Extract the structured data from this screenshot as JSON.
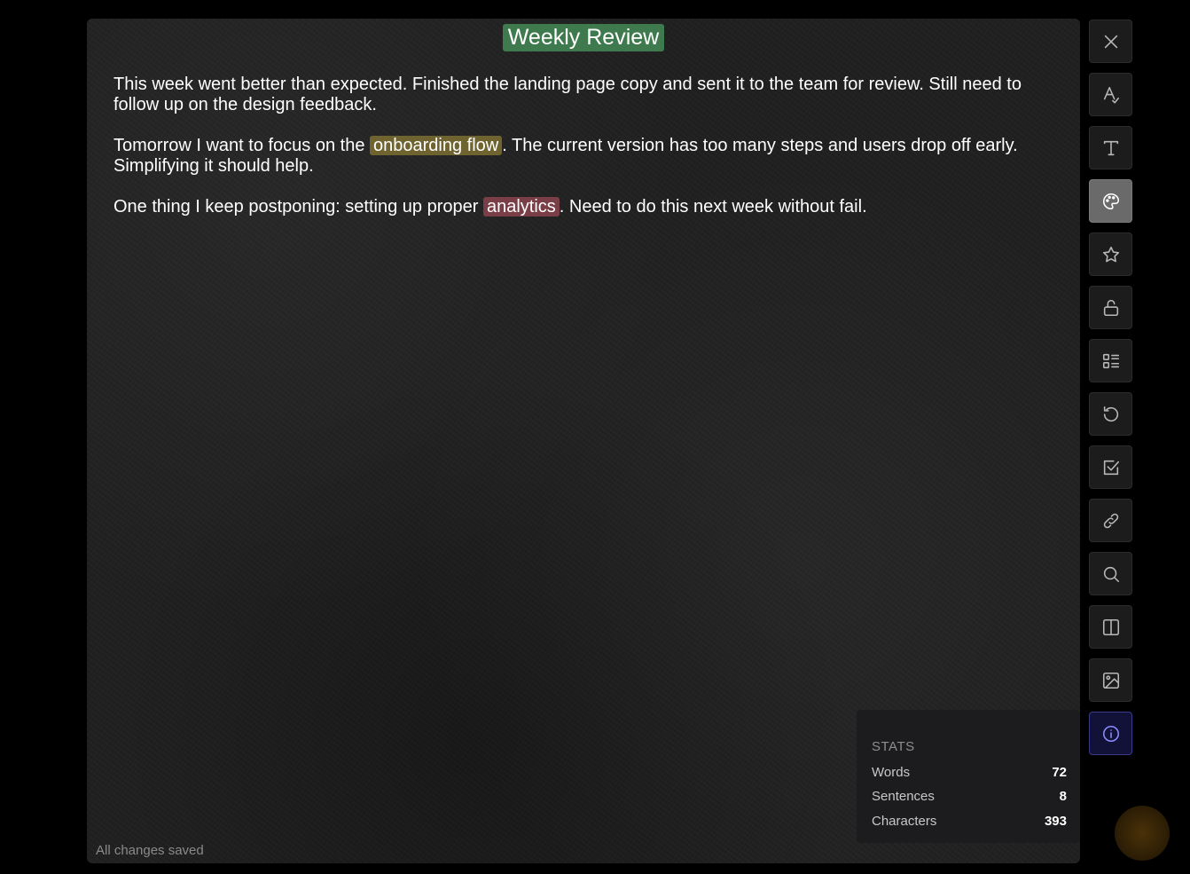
{
  "document": {
    "title": "Weekly Review",
    "paragraphs": [
      {
        "before": "This week went better than expected. Finished the landing page copy and sent it to the team for review. Still need to follow up on the design feedback.",
        "highlight": "",
        "after": ""
      },
      {
        "before": "Tomorrow I want to focus on the ",
        "highlight": "onboarding flow",
        "after": ". The current version has too many steps and users drop off early. Simplifying it should help."
      },
      {
        "before": "One thing I keep postponing: setting up proper ",
        "highlight": "analytics",
        "after": ". Need to do this next week without fail."
      }
    ],
    "status": "All changes saved"
  },
  "colors": {
    "title_bg": "#3f7a4e",
    "highlight_yellow": "#6f6430",
    "highlight_red": "#7a3e47",
    "info_accent": "#8a8cff"
  },
  "stats": {
    "title": "STATS",
    "rows": [
      {
        "label": "Words",
        "value": "72"
      },
      {
        "label": "Sentences",
        "value": "8"
      },
      {
        "label": "Characters",
        "value": "393"
      }
    ]
  },
  "toolbar": {
    "icons": [
      "close-icon",
      "spellcheck-icon",
      "font-icon",
      "palette-icon",
      "star-icon",
      "unlock-icon",
      "list-icon",
      "history-icon",
      "checkbox-icon",
      "link-icon",
      "search-icon",
      "split-view-icon",
      "image-icon",
      "info-icon"
    ]
  }
}
